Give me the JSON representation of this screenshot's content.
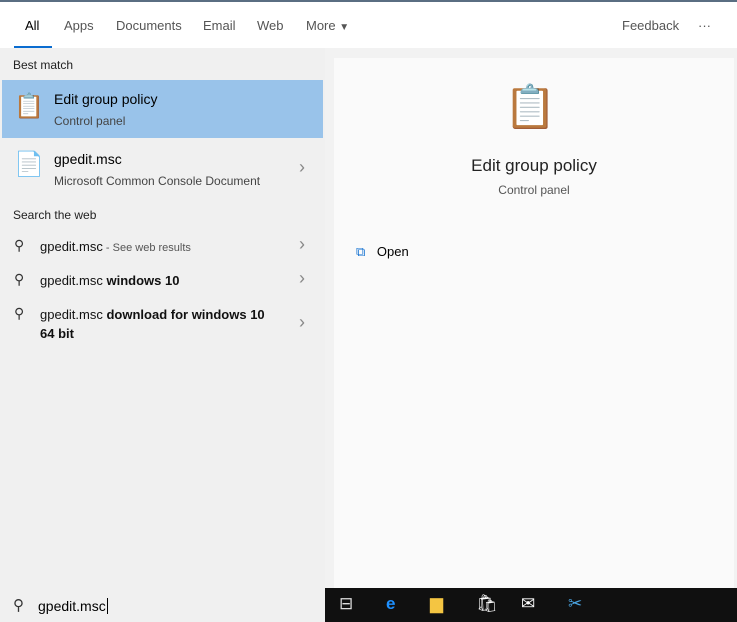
{
  "tabs": [
    "All",
    "Apps",
    "Documents",
    "Email",
    "Web",
    "More"
  ],
  "feedback": "Feedback",
  "more_menu": "···",
  "best_match_label": "Best match",
  "best_match": {
    "title": "Edit group policy",
    "subtitle": "Control panel"
  },
  "result2": {
    "title": "gpedit.msc",
    "subtitle": "Microsoft Common Console Document"
  },
  "web_label": "Search the web",
  "web_results": [
    {
      "query": "gpedit.msc",
      "suffix": " - See web results"
    },
    {
      "query": "gpedit.msc",
      "suffix": " windows 10"
    },
    {
      "query": "gpedit.msc",
      "suffix": " download for windows 10 64 bit"
    }
  ],
  "preview": {
    "title": "Edit group policy",
    "subtitle": "Control panel",
    "action": "Open"
  },
  "search": {
    "value": "gpedit.msc"
  }
}
